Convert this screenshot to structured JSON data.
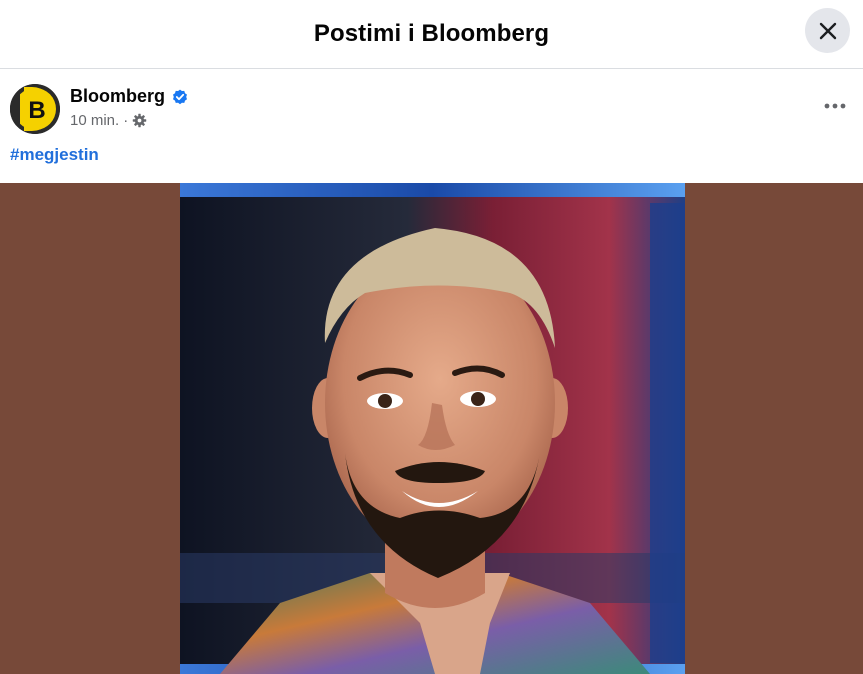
{
  "dialog": {
    "title": "Postimi i Bloomberg",
    "close_icon": "close-icon"
  },
  "post": {
    "author": "Bloomberg",
    "avatar_letter": "B",
    "verified_icon": "verified-badge-icon",
    "time": "10 min.",
    "separator": "·",
    "audience_icon": "gear-icon",
    "more_icon": "more-options-icon",
    "hashtag": "#megjestin"
  },
  "colors": {
    "accent_link": "#216fdb",
    "verified": "#1877f2",
    "media_background": "#774939",
    "avatar_yellow": "#f5d100"
  }
}
